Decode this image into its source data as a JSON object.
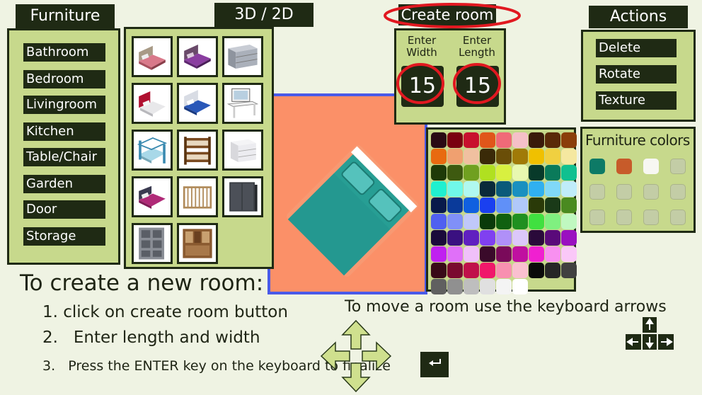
{
  "furniture_panel": {
    "title": "Furniture",
    "categories": [
      "Bathroom",
      "Bedroom",
      "Livingroom",
      "Kitchen",
      "Table/Chair",
      "Garden",
      "Door",
      "Storage"
    ]
  },
  "view_toggle": {
    "label": "3D / 2D"
  },
  "catalog": {
    "items": [
      "bed-pink-icon",
      "bed-purple-icon",
      "dresser-gray-icon",
      "bed-red-icon",
      "bed-blue-icon",
      "vanity-desk-icon",
      "bunk-bed-blue-icon",
      "bunk-bed-wood-icon",
      "nightstand-white-icon",
      "bed-magenta-icon",
      "crib-wood-icon",
      "wardrobe-dark-icon",
      "shelf-gray-icon",
      "cabinet-wood-icon"
    ]
  },
  "create_room": {
    "button_label": "Create room",
    "width_label_line1": "Enter",
    "width_label_line2": "Width",
    "length_label_line1": "Enter",
    "length_label_line2": "Length",
    "width_value": "15",
    "length_value": "15"
  },
  "actions": {
    "title": "Actions",
    "buttons": [
      "Delete",
      "Rotate",
      "Texture"
    ]
  },
  "furniture_colors": {
    "title": "Furniture colors",
    "colors": [
      "#0d7a66",
      "#c75b2a",
      "#f7f7f2",
      "#c3cda6",
      "#c3cda6",
      "#c3cda6",
      "#c3cda6",
      "#c3cda6",
      "#c3cda6",
      "#c3cda6",
      "#c3cda6",
      "#c3cda6"
    ]
  },
  "palette": {
    "colors": [
      "#2a0a14",
      "#7a0010",
      "#c8102e",
      "#e0561a",
      "#f06a78",
      "#f5c0c8",
      "#3a1a0a",
      "#5a2a08",
      "#8a3e0a",
      "#e86a10",
      "#f0a070",
      "#f0c0a0",
      "#3a2a08",
      "#6a4e08",
      "#a07a08",
      "#f0c000",
      "#f0d040",
      "#f5e8a0",
      "#1e3a08",
      "#3e5a10",
      "#70a020",
      "#b0e020",
      "#d8f040",
      "#e8f8b0",
      "#083a2a",
      "#0a7a5a",
      "#10c090",
      "#20f0d0",
      "#70f8e8",
      "#b0f8f0",
      "#0a2a3a",
      "#0a5a7a",
      "#1a90c0",
      "#30b0f0",
      "#80d8f8",
      "#c0ecfa",
      "#081a4a",
      "#0a3a9a",
      "#1060e0",
      "#1a40f0",
      "#6090f8",
      "#b0c8fa",
      "#2a3a08",
      "#1a3a18",
      "#4a8a20",
      "#5060f0",
      "#8090f8",
      "#c0c8fa",
      "#0a3a0a",
      "#106010",
      "#209020",
      "#40e040",
      "#80f080",
      "#c0f8c0",
      "#1a0a3a",
      "#3a1080",
      "#6020c0",
      "#8040f0",
      "#b090f8",
      "#dcc8fa",
      "#2a0a3a",
      "#5a0a7a",
      "#9a10c0",
      "#c020f0",
      "#e070f8",
      "#f0c0fa",
      "#3a0a2a",
      "#7a0a5a",
      "#c010a0",
      "#f020d0",
      "#f890f0",
      "#fac8f8",
      "#3a0a18",
      "#7a0a30",
      "#c0104a",
      "#f0186a",
      "#f890b0",
      "#fac0d0",
      "#0a0a0a",
      "#262626",
      "#404040",
      "#606060",
      "#909090",
      "#bebebe",
      "#e0e0e0",
      "#f4f4f4",
      "#ffffff"
    ]
  },
  "instructions": {
    "heading": "To create a new room:",
    "step1": "1. click on create room button",
    "step2": "2.   Enter length and width",
    "step3": "3.   Press the ENTER key on the keyboard to finalize",
    "move_hint": "To move a room use the keyboard arrows"
  },
  "colors": {
    "panel_bg": "#c7d98c",
    "dark": "#1f2a14",
    "room_floor": "#fb9068",
    "room_border": "#4a5ae8",
    "bed_teal": "#279e94",
    "highlight_red": "#e11820"
  }
}
